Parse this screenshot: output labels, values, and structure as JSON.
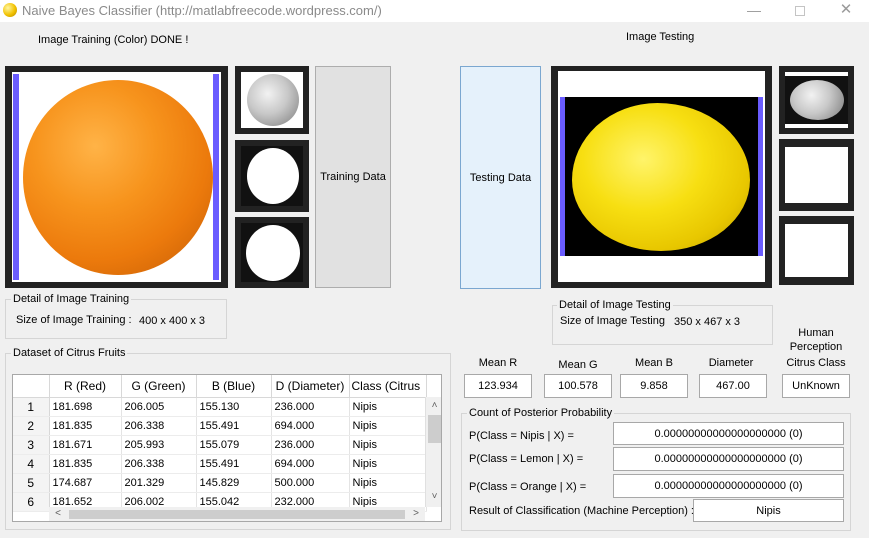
{
  "window": {
    "title": "Naive Bayes Classifier (http://matlabfreecode.wordpress.com/)",
    "minimize": "—",
    "close": "✕"
  },
  "training": {
    "status": "Image Training (Color) DONE !",
    "button": "Training Data",
    "detail_title": "Detail of Image Training",
    "size_label": "Size of Image Training :",
    "size_value": "400 x 400 x 3"
  },
  "testing": {
    "title": "Image Testing",
    "button": "Testing Data",
    "detail_title": "Detail of Image Testing",
    "size_label": "Size of Image Testing",
    "size_value": "350 x 467 x 3"
  },
  "dataset": {
    "title": "Dataset of Citrus Fruits",
    "columns": [
      "",
      "R (Red)",
      "G (Green)",
      "B (Blue)",
      "D (Diameter)",
      "Class (Citrus"
    ],
    "rows": [
      [
        "1",
        "181.698",
        "206.005",
        "155.130",
        "236.000",
        "Nipis"
      ],
      [
        "2",
        "181.835",
        "206.338",
        "155.491",
        "694.000",
        "Nipis"
      ],
      [
        "3",
        "181.671",
        "205.993",
        "155.079",
        "236.000",
        "Nipis"
      ],
      [
        "4",
        "181.835",
        "206.338",
        "155.491",
        "694.000",
        "Nipis"
      ],
      [
        "5",
        "174.687",
        "201.329",
        "145.829",
        "500.000",
        "Nipis"
      ],
      [
        "6",
        "181.652",
        "206.002",
        "155.042",
        "232.000",
        "Nipis"
      ]
    ]
  },
  "features": {
    "human_perception": "Human\nPerception",
    "mean_r": {
      "label": "Mean R",
      "value": "123.934"
    },
    "mean_g": {
      "label": "Mean G",
      "value": "100.578"
    },
    "mean_b": {
      "label": "Mean B",
      "value": "9.858"
    },
    "diameter": {
      "label": "Diameter",
      "value": "467.00"
    },
    "citrus_class": {
      "label": "Citrus Class",
      "value": "UnKnown"
    }
  },
  "posterior": {
    "title": "Count of  Posterior Probability",
    "nipis": {
      "label": "P(Class = Nipis | X) =",
      "value": "0.00000000000000000000  (0)"
    },
    "lemon": {
      "label": "P(Class = Lemon | X) =",
      "value": "0.00000000000000000000  (0)"
    },
    "orange": {
      "label": "P(Class = Orange | X) =",
      "value": "0.00000000000000000000  (0)"
    },
    "result_label": "Result of Classification (Machine Perception) :",
    "result_value": "Nipis"
  },
  "colors": {
    "accent_border": "#6a5cff",
    "frame": "#222222"
  }
}
